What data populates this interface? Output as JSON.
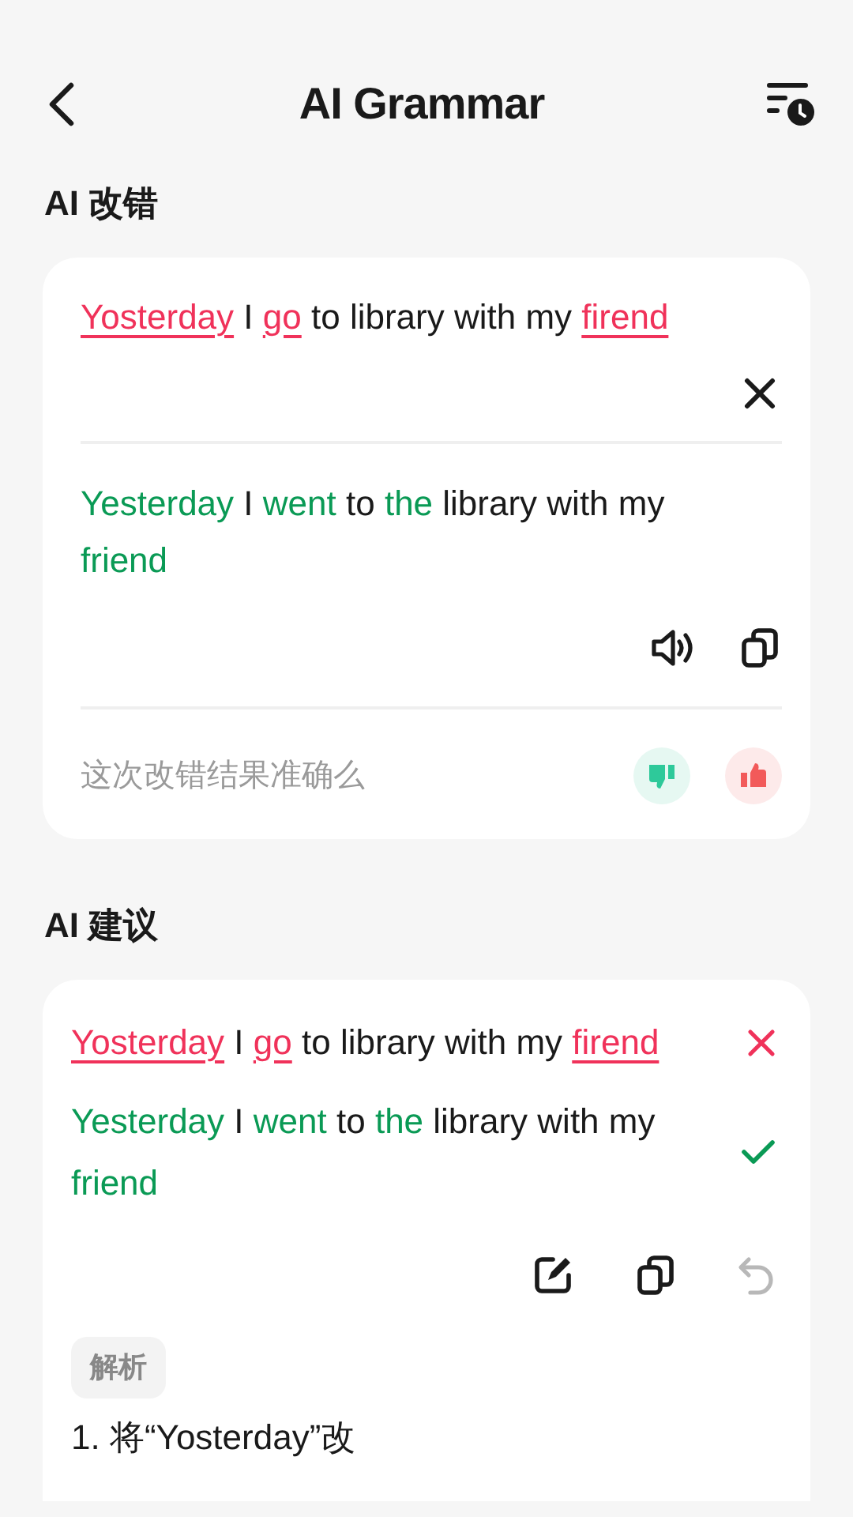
{
  "header": {
    "title": "AI Grammar"
  },
  "correction": {
    "heading": "AI 改错",
    "original": [
      {
        "text": "Yosterday",
        "kind": "error"
      },
      {
        "text": " I ",
        "kind": "plain"
      },
      {
        "text": "go",
        "kind": "error"
      },
      {
        "text": " to library with my ",
        "kind": "plain"
      },
      {
        "text": "firend",
        "kind": "error"
      }
    ],
    "corrected": [
      {
        "text": "Yesterday",
        "kind": "fix"
      },
      {
        "text": " I ",
        "kind": "plain"
      },
      {
        "text": "went",
        "kind": "fix"
      },
      {
        "text": " to ",
        "kind": "plain"
      },
      {
        "text": "the",
        "kind": "fix"
      },
      {
        "text": " library with my ",
        "kind": "plain"
      },
      {
        "text": "friend",
        "kind": "fix"
      }
    ],
    "feedback_prompt": "这次改错结果准确么"
  },
  "suggestion": {
    "heading": "AI 建议",
    "original": [
      {
        "text": "Yosterday",
        "kind": "error"
      },
      {
        "text": " I ",
        "kind": "plain"
      },
      {
        "text": "go",
        "kind": "error"
      },
      {
        "text": " to library with my ",
        "kind": "plain"
      },
      {
        "text": "firend",
        "kind": "error"
      }
    ],
    "corrected": [
      {
        "text": "Yesterday",
        "kind": "fix"
      },
      {
        "text": " I ",
        "kind": "plain"
      },
      {
        "text": "went",
        "kind": "fix"
      },
      {
        "text": " to ",
        "kind": "plain"
      },
      {
        "text": "the",
        "kind": "fix"
      },
      {
        "text": " library with my ",
        "kind": "plain"
      },
      {
        "text": "friend",
        "kind": "fix"
      }
    ],
    "undo_disabled": true,
    "analysis_label": "解析",
    "analysis_lines": [
      "1. 将“Yosterday”改"
    ]
  }
}
